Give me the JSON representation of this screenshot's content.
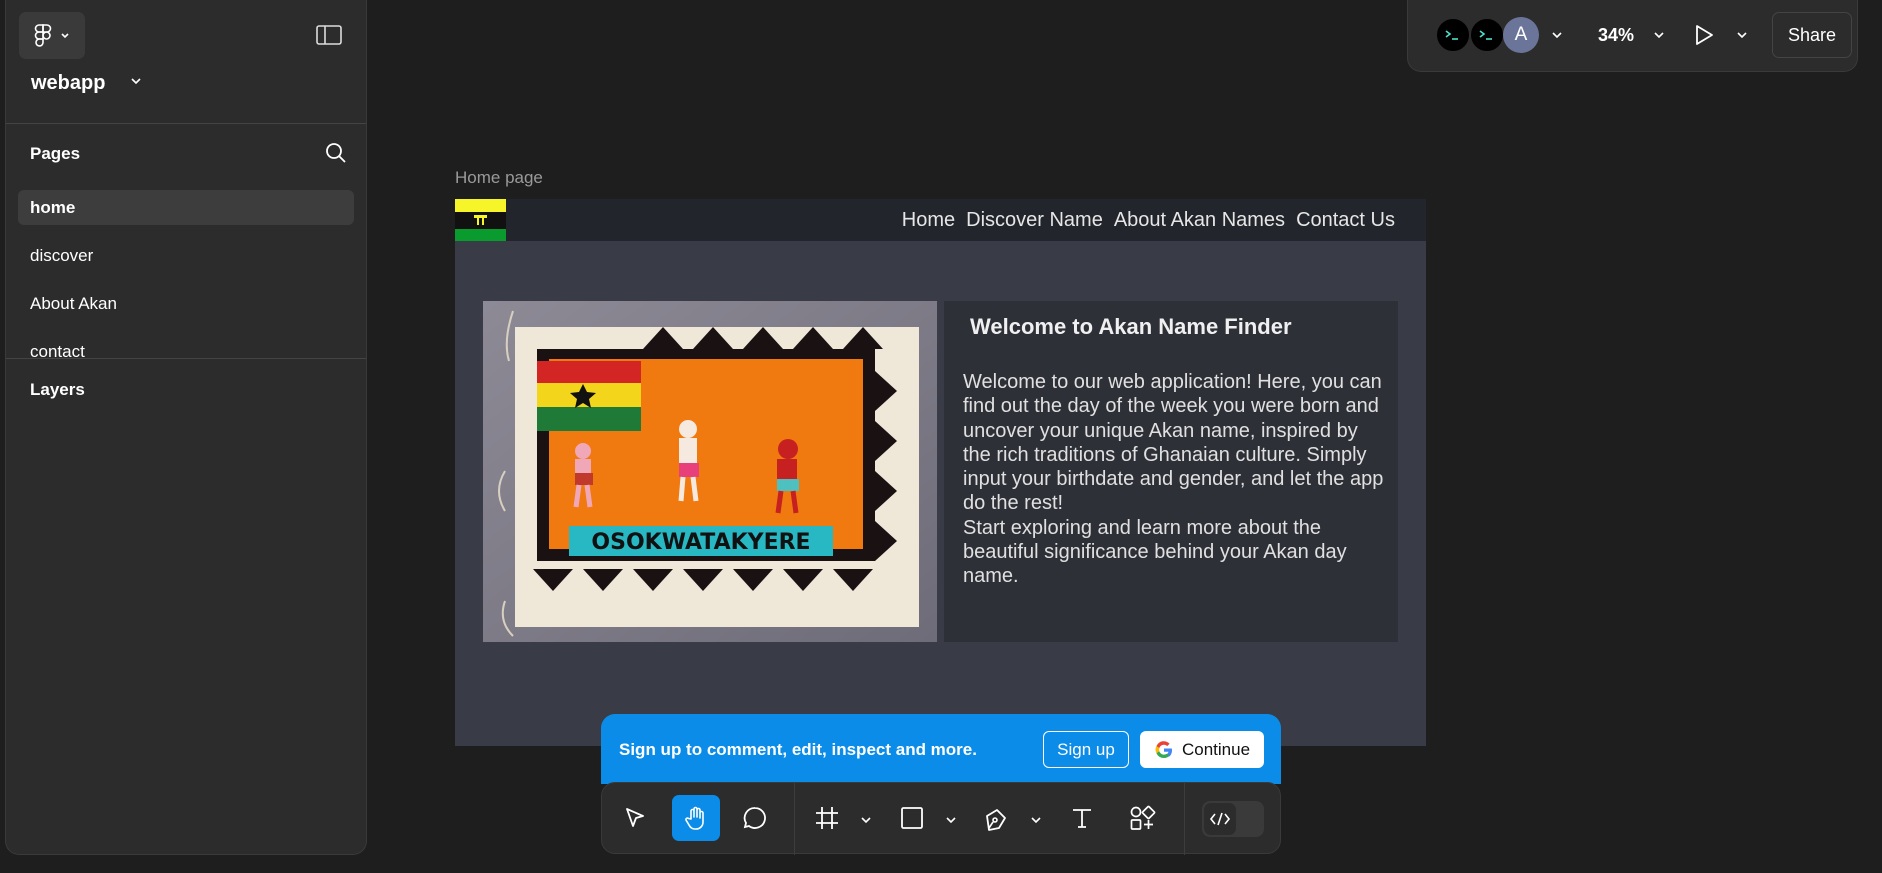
{
  "sidebar": {
    "project_title": "webapp",
    "pages_title": "Pages",
    "pages": [
      {
        "label": "home",
        "active": true
      },
      {
        "label": "discover",
        "active": false
      },
      {
        "label": "About Akan",
        "active": false
      },
      {
        "label": "contact",
        "active": false
      }
    ],
    "layers_title": "Layers"
  },
  "topbar": {
    "avatar_letter": "A",
    "zoom": "34%",
    "share_label": "Share"
  },
  "canvas": {
    "frame_label": "Home page",
    "nav_links": [
      "Home",
      "Discover Name",
      "About Akan Names",
      "Contact Us"
    ],
    "welcome_title": "Welcome to Akan Name Finder",
    "welcome_paragraph_1": "Welcome to our web application! Here, you can find out the day of the week you were born and uncover your unique Akan name, inspired by the rich traditions of Ghanaian culture. Simply input your birthdate and gender, and let the app do the rest!",
    "welcome_paragraph_2": "Start exploring and learn more about the beautiful significance behind your Akan day name.",
    "banner_text": "OSOKWATAKYERE"
  },
  "signup": {
    "message": "Sign up to comment, edit, inspect and more.",
    "signup_label": "Sign up",
    "continue_label": "Continue"
  },
  "colors": {
    "accent": "#0c8ce9",
    "panel": "#2c2c2c",
    "canvas_bg": "#1e1e1e",
    "frame_bg": "#393c46"
  },
  "icons": [
    "figma-logo-icon",
    "chevron-down-icon",
    "sidebar-toggle-icon",
    "search-icon",
    "terminal-icon",
    "play-icon",
    "move-icon",
    "hand-icon",
    "comment-icon",
    "frame-icon",
    "rectangle-icon",
    "pen-icon",
    "text-icon",
    "actions-icon",
    "code-icon",
    "google-icon"
  ]
}
